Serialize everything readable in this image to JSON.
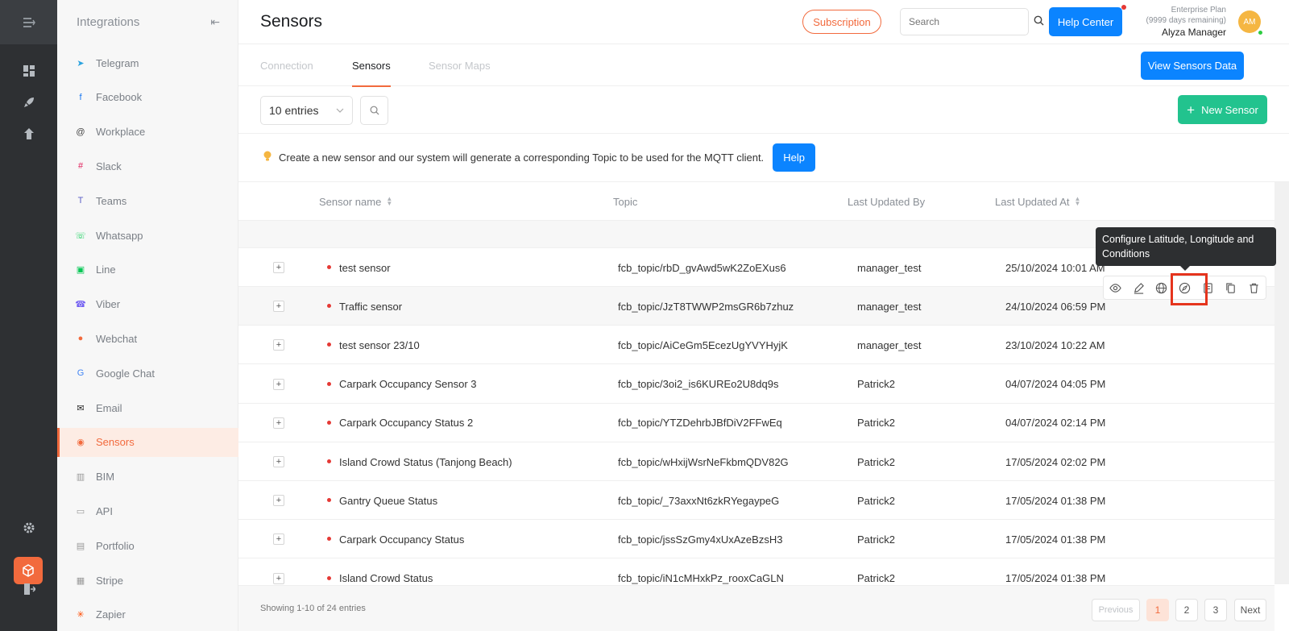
{
  "sidebar": {
    "title": "Integrations",
    "items": [
      {
        "label": "Telegram",
        "icon": "telegram-icon",
        "color": "#2aa3df"
      },
      {
        "label": "Facebook",
        "icon": "facebook-icon",
        "color": "#1877f2"
      },
      {
        "label": "Workplace",
        "icon": "workplace-icon",
        "color": "#444444"
      },
      {
        "label": "Slack",
        "icon": "slack-icon",
        "color": "#e01e5a"
      },
      {
        "label": "Teams",
        "icon": "teams-icon",
        "color": "#5b5fc7"
      },
      {
        "label": "Whatsapp",
        "icon": "whatsapp-icon",
        "color": "#25d366"
      },
      {
        "label": "Line",
        "icon": "line-icon",
        "color": "#06c755"
      },
      {
        "label": "Viber",
        "icon": "viber-icon",
        "color": "#7360f2"
      },
      {
        "label": "Webchat",
        "icon": "webchat-icon",
        "color": "#f26a3d"
      },
      {
        "label": "Google Chat",
        "icon": "google-chat-icon",
        "color": "#4285f4"
      },
      {
        "label": "Email",
        "icon": "email-icon",
        "color": "#222222"
      },
      {
        "label": "Sensors",
        "icon": "sensors-icon",
        "color": "#f26a3d"
      },
      {
        "label": "BIM",
        "icon": "bim-icon",
        "color": "#999999"
      },
      {
        "label": "API",
        "icon": "api-icon",
        "color": "#999999"
      },
      {
        "label": "Portfolio",
        "icon": "portfolio-icon",
        "color": "#999999"
      },
      {
        "label": "Stripe",
        "icon": "stripe-icon",
        "color": "#999999"
      },
      {
        "label": "Zapier",
        "icon": "zapier-icon",
        "color": "#ff4a00"
      }
    ]
  },
  "header": {
    "title": "Sensors",
    "subscription_label": "Subscription",
    "search_placeholder": "Search",
    "help_center_label": "Help Center",
    "plan_name": "Enterprise Plan",
    "plan_remaining": "(9999 days remaining)",
    "user_name": "Alyza Manager",
    "avatar_initials": "AM"
  },
  "tabs": {
    "items": [
      "Connection",
      "Sensors",
      "Sensor Maps"
    ],
    "active": "Sensors",
    "view_data_label": "View Sensors Data"
  },
  "toolbar": {
    "entries_label": "10 entries",
    "new_sensor_label": "New Sensor"
  },
  "info": {
    "message": "Create a new sensor and our system will generate a corresponding Topic to be used for the MQTT client.",
    "help_label": "Help"
  },
  "table": {
    "columns": [
      "Sensor name",
      "Topic",
      "Last Updated By",
      "Last Updated At"
    ],
    "rows": [
      {
        "name": "test sensor",
        "topic": "fcb_topic/rbD_gvAwd5wK2ZoEXus6",
        "updated_by": "manager_test",
        "updated_at": "25/10/2024 10:01 AM"
      },
      {
        "name": "Traffic sensor",
        "topic": "fcb_topic/JzT8TWWP2msGR6b7zhuz",
        "updated_by": "manager_test",
        "updated_at": "24/10/2024 06:59 PM"
      },
      {
        "name": "test sensor 23/10",
        "topic": "fcb_topic/AiCeGm5EcezUgYVYHyjK",
        "updated_by": "manager_test",
        "updated_at": "23/10/2024 10:22 AM"
      },
      {
        "name": "Carpark Occupancy Sensor 3",
        "topic": "fcb_topic/3oi2_is6KUREo2U8dq9s",
        "updated_by": "Patrick2",
        "updated_at": "04/07/2024 04:05 PM"
      },
      {
        "name": "Carpark Occupancy Status 2",
        "topic": "fcb_topic/YTZDehrbJBfDiV2FFwEq",
        "updated_by": "Patrick2",
        "updated_at": "04/07/2024 02:14 PM"
      },
      {
        "name": "Island Crowd Status (Tanjong Beach)",
        "topic": "fcb_topic/wHxijWsrNeFkbmQDV82G",
        "updated_by": "Patrick2",
        "updated_at": "17/05/2024 02:02 PM"
      },
      {
        "name": "Gantry Queue Status",
        "topic": "fcb_topic/_73axxNt6zkRYegaypeG",
        "updated_by": "Patrick2",
        "updated_at": "17/05/2024 01:38 PM"
      },
      {
        "name": "Carpark Occupancy Status",
        "topic": "fcb_topic/jssSzGmy4xUxAzeBzsH3",
        "updated_by": "Patrick2",
        "updated_at": "17/05/2024 01:38 PM"
      },
      {
        "name": "Island Crowd Status",
        "topic": "fcb_topic/iN1cMHxkPz_rooxCaGLN",
        "updated_by": "Patrick2",
        "updated_at": "17/05/2024 01:38 PM"
      }
    ]
  },
  "row_actions": {
    "icons": [
      "view-icon",
      "edit-icon",
      "globe-icon",
      "compass-icon",
      "document-icon",
      "copy-icon",
      "trash-icon"
    ],
    "tooltip": "Configure Latitude, Longitude and Conditions"
  },
  "footer": {
    "showing": "Showing 1-10 of 24 entries",
    "previous_label": "Previous",
    "pages": [
      "1",
      "2",
      "3"
    ],
    "current_page": "1",
    "next_label": "Next"
  },
  "colors": {
    "accent": "#f26a3d",
    "primary": "#0b84ff",
    "success": "#22c38e",
    "rail": "#2e3033"
  }
}
